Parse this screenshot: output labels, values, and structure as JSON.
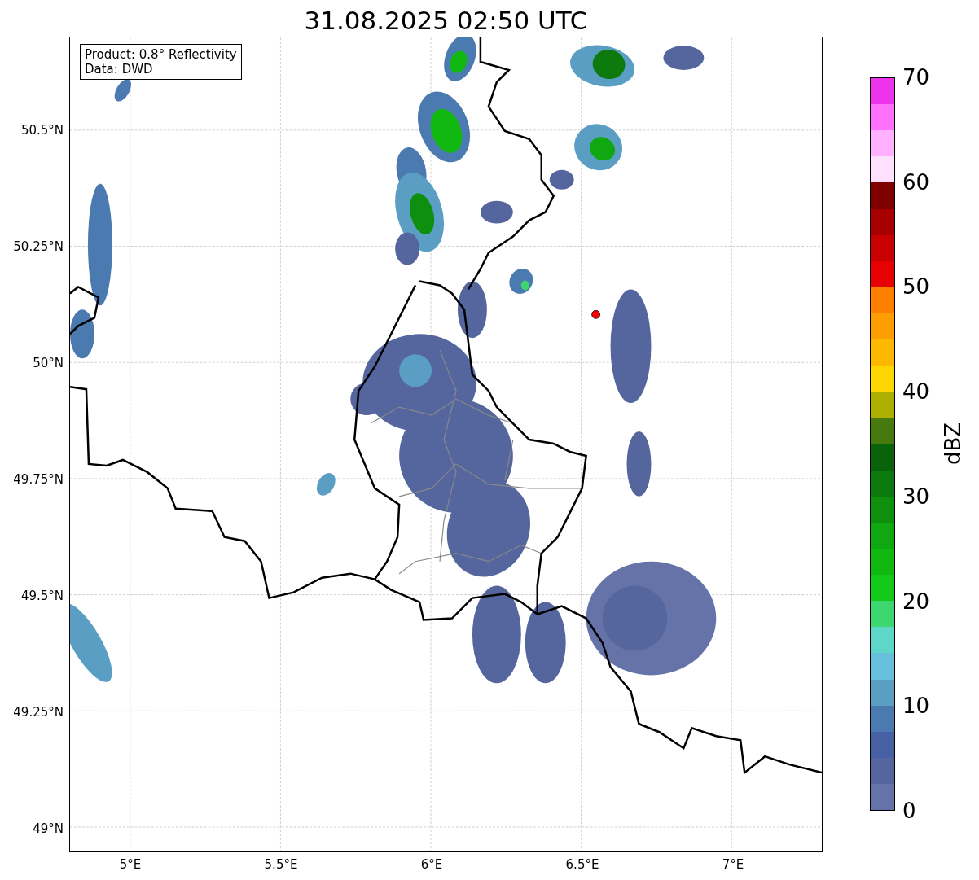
{
  "title": "31.08.2025 02:50 UTC",
  "map": {
    "info_box": [
      "Product: 0.8° Reflectivity",
      "Data: DWD"
    ],
    "x_ticks": [
      "5°E",
      "5.5°E",
      "6°E",
      "6.5°E",
      "7°E"
    ],
    "y_ticks": [
      "50.5°N",
      "50.25°N",
      "50°N",
      "49.75°N",
      "49.5°N",
      "49.25°N",
      "49°N"
    ]
  },
  "colorbar": {
    "label": "dBZ",
    "ticks": [
      "70",
      "60",
      "50",
      "40",
      "30",
      "20",
      "10",
      "0"
    ],
    "steps": [
      {
        "color": "#ee33ee"
      },
      {
        "color": "#ff70ff"
      },
      {
        "color": "#ffb0ff"
      },
      {
        "color": "#ffe0ff"
      },
      {
        "color": "#800000"
      },
      {
        "color": "#a80000"
      },
      {
        "color": "#c80000"
      },
      {
        "color": "#e60000"
      },
      {
        "color": "#ff8000"
      },
      {
        "color": "#ff9e00"
      },
      {
        "color": "#ffb800"
      },
      {
        "color": "#ffd700"
      },
      {
        "color": "#aeb000"
      },
      {
        "color": "#477a0e"
      },
      {
        "color": "#0a620a"
      },
      {
        "color": "#0c7a0c"
      },
      {
        "color": "#0e900e"
      },
      {
        "color": "#10a810"
      },
      {
        "color": "#10b810"
      },
      {
        "color": "#12c818"
      },
      {
        "color": "#3dd66f"
      },
      {
        "color": "#5ed6c8"
      },
      {
        "color": "#66c0dc"
      },
      {
        "color": "#5a9ec4"
      },
      {
        "color": "#4a7ab0"
      },
      {
        "color": "#4660a3"
      },
      {
        "color": "#55669e"
      },
      {
        "color": "#6673a8"
      }
    ]
  }
}
